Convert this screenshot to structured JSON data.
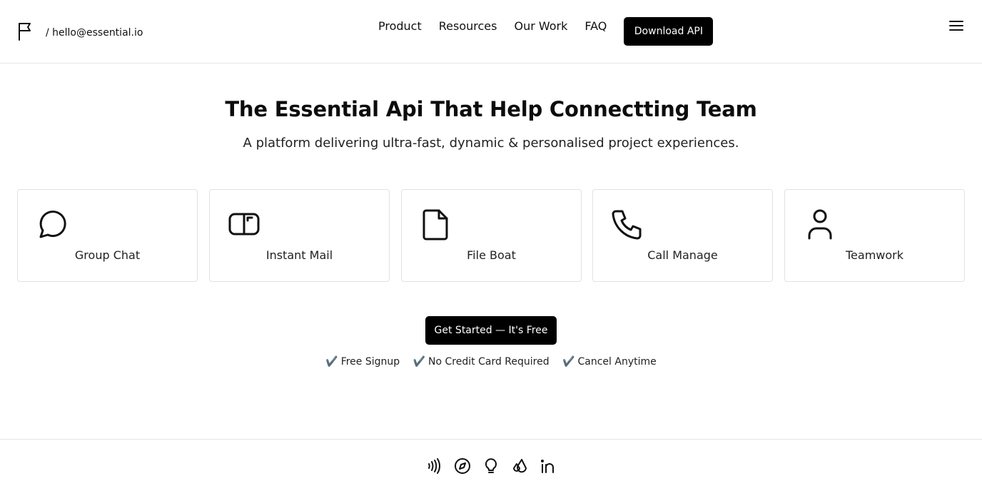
{
  "header": {
    "brand_icon": "flag-icon",
    "contact_email": "/ hello@essential.io",
    "nav": [
      {
        "label": "Product"
      },
      {
        "label": "Resources"
      },
      {
        "label": "Our Work"
      },
      {
        "label": "FAQ"
      }
    ],
    "download_label": "Download API",
    "menu_icon": "hamburger-menu-icon"
  },
  "hero": {
    "title": "The Essential Api That Help Connectting Team",
    "subtitle": "A platform delivering ultra-fast, dynamic & personalised project experiences."
  },
  "features": [
    {
      "label": "Group Chat",
      "icon": "chat-bubble-icon"
    },
    {
      "label": "Instant Mail",
      "icon": "mailbox-icon"
    },
    {
      "label": "File Boat",
      "icon": "file-icon"
    },
    {
      "label": "Call Manage",
      "icon": "phone-icon"
    },
    {
      "label": "Teamwork",
      "icon": "user-icon"
    }
  ],
  "cta": {
    "label": "Get Started — It's Free",
    "perks": [
      "Free Signup",
      "No Credit Card Required",
      "Cancel Anytime"
    ],
    "check_glyph": "✔️"
  },
  "footer": {
    "social_icons": [
      "nfc-icon",
      "compass-icon",
      "lightbulb-icon",
      "droplets-icon",
      "linkedin-icon"
    ]
  },
  "colors": {
    "accent": "#000000",
    "background": "#ffffff",
    "border": "#e5e5e5"
  }
}
